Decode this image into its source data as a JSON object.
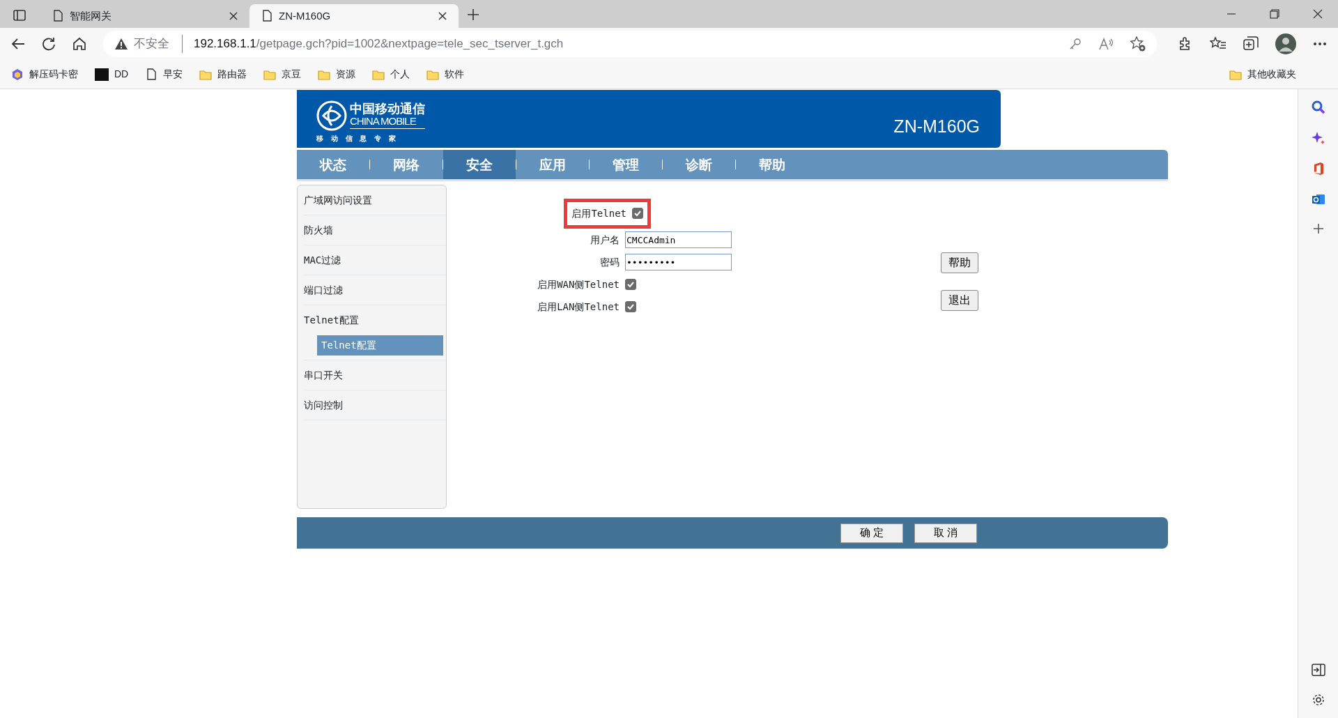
{
  "browser": {
    "tabs": [
      {
        "title": "智能网关",
        "selected": false
      },
      {
        "title": "ZN-M160G",
        "selected": true
      }
    ],
    "address": {
      "warning": "不安全",
      "host": "192.168.1.1",
      "path": "/getpage.gch?pid=1002&nextpage=tele_sec_tserver_t.gch"
    },
    "bookmarks": [
      {
        "label": "解压码卡密",
        "kind": "extension"
      },
      {
        "label": "DD",
        "kind": "pro"
      },
      {
        "label": "早安",
        "kind": "page"
      },
      {
        "label": "路由器",
        "kind": "folder"
      },
      {
        "label": "京豆",
        "kind": "folder"
      },
      {
        "label": "资源",
        "kind": "folder"
      },
      {
        "label": "个人",
        "kind": "folder"
      },
      {
        "label": "软件",
        "kind": "folder"
      }
    ],
    "other_bookmarks": "其他收藏夹"
  },
  "header": {
    "logo_cn": "中国移动通信",
    "logo_en": "CHINA MOBILE",
    "slogan": "移 动 信 息 专 家",
    "model": "ZN-M160G"
  },
  "nav": [
    {
      "label": "状态",
      "selected": false
    },
    {
      "label": "网络",
      "selected": false
    },
    {
      "label": "安全",
      "selected": true
    },
    {
      "label": "应用",
      "selected": false
    },
    {
      "label": "管理",
      "selected": false
    },
    {
      "label": "诊断",
      "selected": false
    },
    {
      "label": "帮助",
      "selected": false
    }
  ],
  "sidebar": [
    {
      "label": "广域网访问设置"
    },
    {
      "label": "防火墙"
    },
    {
      "label": "MAC过滤"
    },
    {
      "label": "端口过滤"
    },
    {
      "label": "Telnet配置",
      "children": [
        {
          "label": "Telnet配置",
          "selected": true
        }
      ]
    },
    {
      "label": "串口开关"
    },
    {
      "label": "访问控制"
    }
  ],
  "form": [
    {
      "kind": "checkbox",
      "label": "启用Telnet",
      "checked": true,
      "highlighted": true
    },
    {
      "kind": "text",
      "label": "用户名",
      "value": "CMCCAdmin",
      "highlighted": false
    },
    {
      "kind": "text",
      "label": "密码",
      "value": "•••••••••",
      "highlighted": false
    },
    {
      "kind": "checkbox",
      "label": "启用WAN侧Telnet",
      "checked": true,
      "highlighted": false
    },
    {
      "kind": "checkbox",
      "label": "启用LAN侧Telnet",
      "checked": true,
      "highlighted": false
    }
  ],
  "side_buttons": [
    "帮助",
    "退出"
  ],
  "footer_buttons": [
    "确 定",
    "取 消"
  ]
}
